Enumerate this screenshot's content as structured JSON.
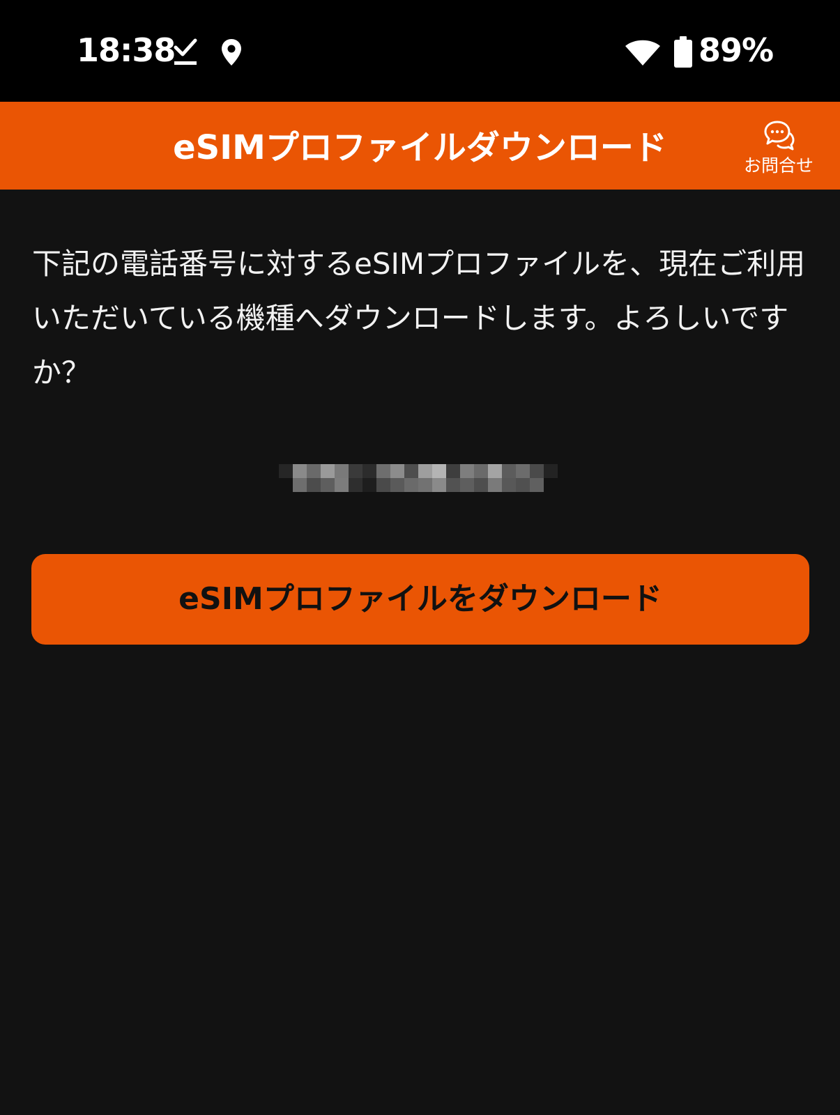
{
  "status_bar": {
    "time": "18:38",
    "battery": "89%",
    "icons": [
      "download-done-icon",
      "location-pin-icon",
      "wifi-icon",
      "battery-icon"
    ]
  },
  "header": {
    "title": "eSIMプロファイルダウンロード",
    "contact_label": "お問合せ",
    "contact_icon": "chat-bubbles-icon",
    "background_color": "#EA5504"
  },
  "main": {
    "message": "下記の電話番号に対するeSIMプロファイルを、現在ご利用いただいている機種へダウンロードします。よろしいですか？",
    "download_button_label": "eSIMプロファイルをダウンロード",
    "background_color": "#121212"
  }
}
